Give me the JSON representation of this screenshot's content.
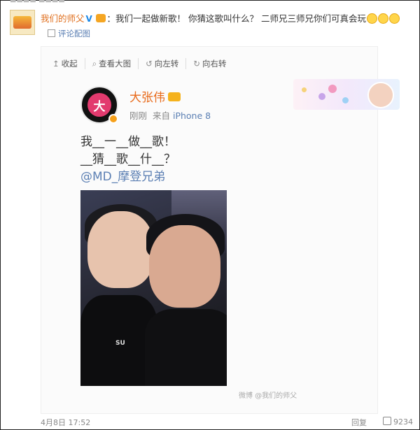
{
  "post": {
    "username": "我们的师父",
    "text": "：我们一起做新歌！ 你猜这歌叫什么？ 二师兄三师兄你们可真会玩",
    "comment_image_label": "评论配图"
  },
  "toolbar": {
    "collapse": "收起",
    "view_large": "查看大图",
    "rotate_left": "向左转",
    "rotate_right": "向右转"
  },
  "card": {
    "avatar_char": "大",
    "poster_name": "大张伟",
    "time": "刚刚",
    "source_prefix": "来自",
    "source": "iPhone 8",
    "lines": [
      "我__一__做__歌！",
      "__猜__歌__什__？"
    ],
    "mention": "@MD_摩登兄弟"
  },
  "photo": {
    "shirt_logo": "SU",
    "watermark": "微博 @我们的师父"
  },
  "footer": {
    "time": "4月8日 17:52",
    "reply": "回复",
    "likes": "9234"
  },
  "colors": {
    "username": "#e0701f",
    "link": "#5b7fb3",
    "poster_name": "#e86a1a"
  },
  "icons": [
    "v-badge-icon",
    "vip-icon",
    "smile-emoji-icon",
    "checkbox-icon",
    "collapse-icon",
    "zoom-icon",
    "rotate-left-icon",
    "rotate-right-icon",
    "crown-icon",
    "like-icon"
  ]
}
